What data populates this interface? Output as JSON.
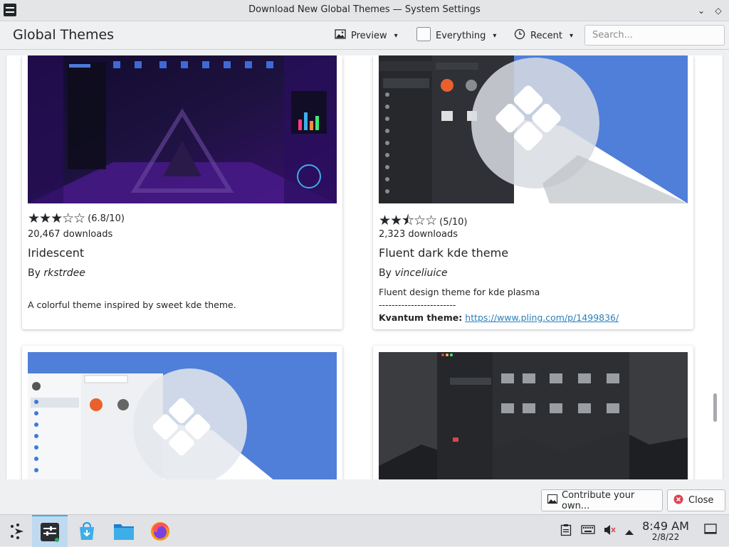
{
  "window": {
    "title": "Download New Global Themes — System Settings"
  },
  "header": {
    "page_title": "Global Themes",
    "preview_label": "Preview",
    "filter_label": "Everything",
    "sort_label": "Recent",
    "search_placeholder": "Search..."
  },
  "cards": [
    {
      "rating_text": "(6.8/10)",
      "stars": "★★★☆☆",
      "downloads": "20,467 downloads",
      "name": "Iridescent",
      "author_prefix": "By",
      "author": "rkstrdee",
      "description": "A colorful theme inspired by sweet kde theme."
    },
    {
      "rating_text": "(5/10)",
      "stars": "★★⯪☆☆",
      "downloads": "2,323 downloads",
      "name": "Fluent dark kde theme",
      "author_prefix": "By",
      "author": "vinceliuice",
      "description": "Fluent design theme for kde plasma",
      "separator": "------------------------",
      "kvantum_label": "Kvantum theme:",
      "kvantum_link": "https://www.pling.com/p/1499836/"
    }
  ],
  "footer": {
    "contribute_label": "Contribute your own...",
    "close_label": "Close"
  },
  "taskbar": {
    "time": "8:49 AM",
    "date": "2/8/22"
  },
  "colors": {
    "accent": "#3daee9",
    "link": "#2980b9",
    "close_icon": "#da4453"
  }
}
